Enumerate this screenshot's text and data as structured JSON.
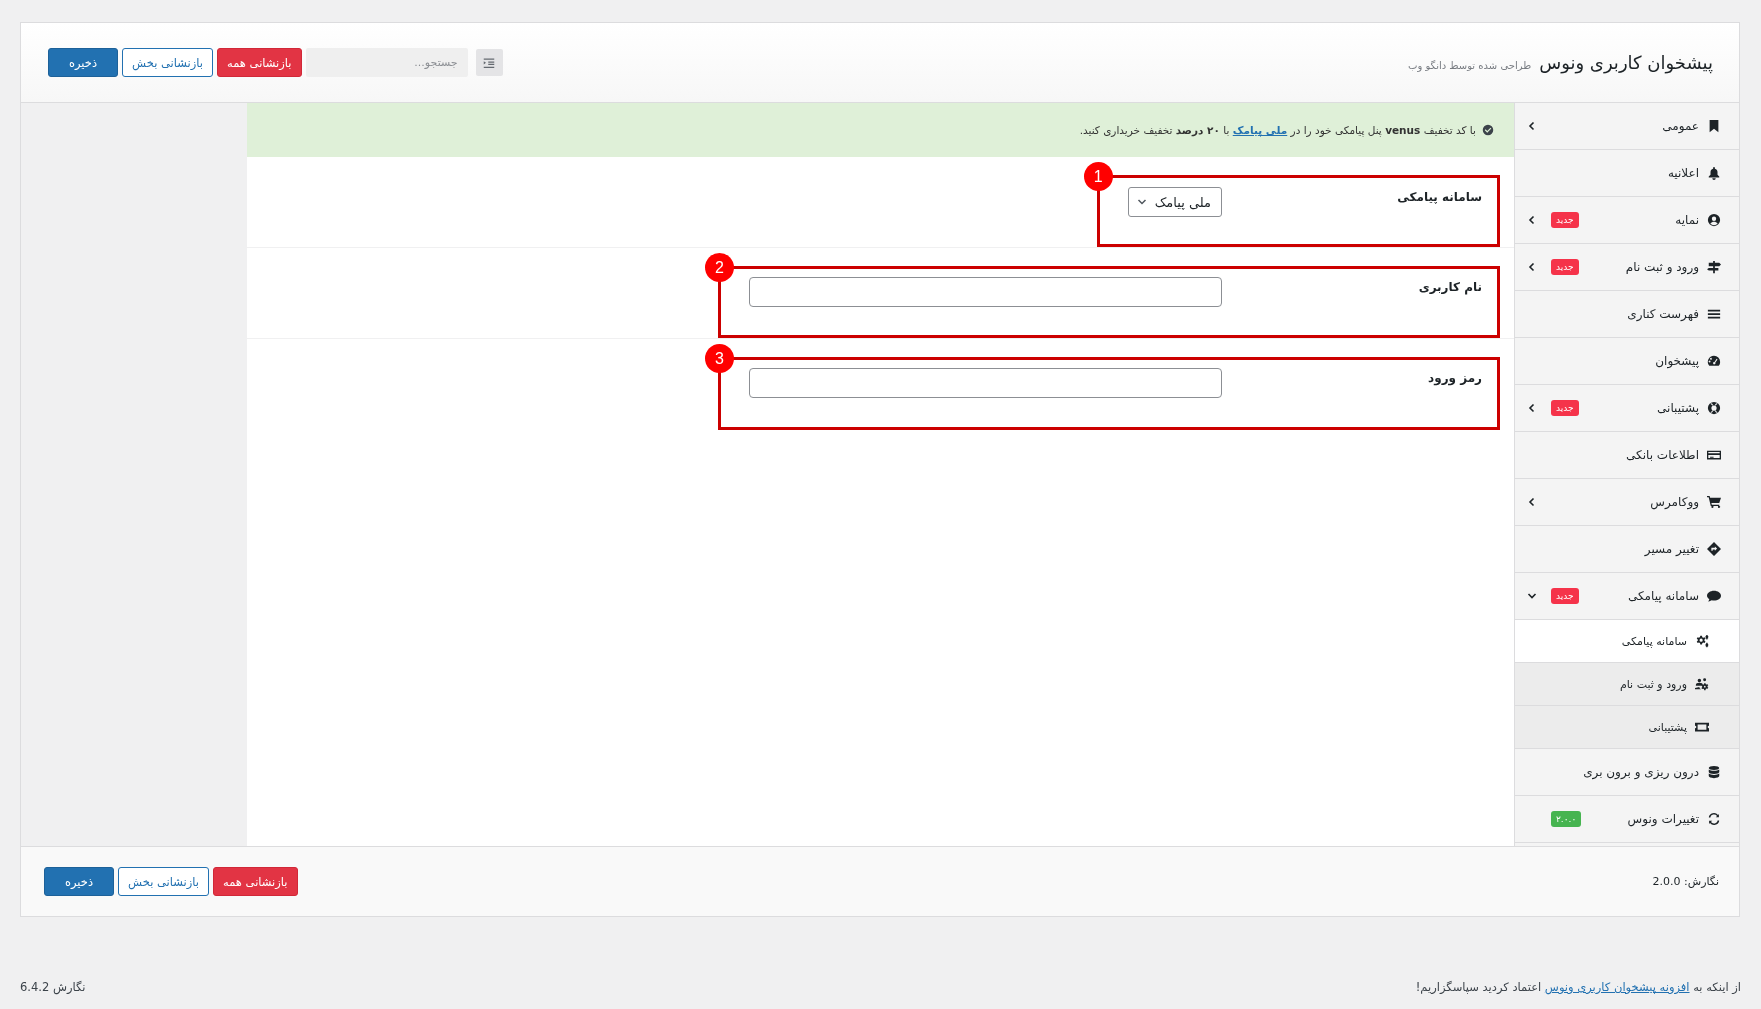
{
  "header": {
    "title": "پیشخوان کاربری ونوس",
    "subtitle": "طراحی شده توسط دانگو وب",
    "search": {
      "placeholder": "جستجو..."
    },
    "buttons": [
      {
        "label": "بازنشانی همه",
        "kind": "danger"
      },
      {
        "label": "بازنشانی بخش",
        "kind": "outline"
      },
      {
        "label": "ذخیره",
        "kind": "primary"
      }
    ]
  },
  "sidebar": {
    "items": [
      {
        "label": "عمومی",
        "expanded": false
      },
      {
        "label": "اعلانیه"
      },
      {
        "label": "نمایه",
        "badge": {
          "text": "جدید",
          "color": "#f5334a"
        },
        "expanded": false
      },
      {
        "label": "ورود و ثبت نام",
        "badge": {
          "text": "جدید",
          "color": "#f5334a"
        },
        "expanded": false
      },
      {
        "label": "فهرست کناری"
      },
      {
        "label": "پیشخوان"
      },
      {
        "label": "پشتیبانی",
        "badge": {
          "text": "جدید",
          "color": "#f5334a"
        },
        "expanded": false
      },
      {
        "label": "اطلاعات بانکی"
      },
      {
        "label": "ووکامرس",
        "expanded": false
      },
      {
        "label": "تغییر مسیر"
      },
      {
        "label": "سامانه پیامکی",
        "badge": {
          "text": "جدید",
          "color": "#f5334a"
        },
        "expanded": true,
        "children": [
          {
            "label": "سامانه پیامکی",
            "selected": true
          },
          {
            "label": "ورود و ثبت نام",
            "selected": false
          },
          {
            "label": "پشتیبانی",
            "selected": false
          }
        ]
      },
      {
        "label": "درون ریزی و برون بری"
      },
      {
        "label": "تغییرات ونوس",
        "badge": {
          "text": "۲.۰.۰",
          "color": "#46b450"
        }
      }
    ]
  },
  "notice": {
    "before": "با کد تخفیف **venus** پنل پیامکی خود را در",
    "link": "ملی پیامک",
    "after": "با **۲۰ درصد** تخفیف خریداری کنید."
  },
  "fields": [
    {
      "label": "سامانه پیامکی",
      "kind": "select",
      "value": "ملی پیامک",
      "annotation": "1"
    },
    {
      "label": "نام کاربری",
      "kind": "text",
      "annotation": "2"
    },
    {
      "label": "رمز ورود",
      "kind": "password",
      "annotation": "3"
    }
  ],
  "footer": {
    "version": "نگارش: 2.0.0",
    "buttons": [
      {
        "label": "بازنشانی همه",
        "kind": "danger"
      },
      {
        "label": "بازنشانی بخش",
        "kind": "outline"
      },
      {
        "label": "ذخیره",
        "kind": "primary"
      }
    ]
  },
  "page_footer": {
    "thanks": {
      "before": "از اینکه به",
      "link": "افزونه پیشخوان کاربری ونوس",
      "after": "اعتماد کردید سپاسگزاریم!"
    },
    "wp_version": "نگارش 6.4.2"
  }
}
